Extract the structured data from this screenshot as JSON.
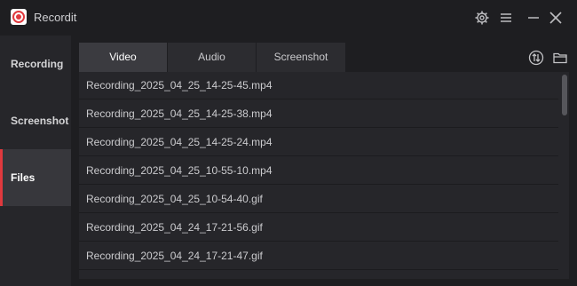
{
  "app": {
    "title": "Recordit"
  },
  "titlebar_icons": [
    "gear-icon",
    "menu-icon",
    "minimize-icon",
    "close-icon"
  ],
  "sidebar": {
    "items": [
      {
        "label": "Recording",
        "active": false
      },
      {
        "label": "Screenshot",
        "active": false
      },
      {
        "label": "Files",
        "active": true
      }
    ]
  },
  "tabs": [
    {
      "label": "Video",
      "active": true
    },
    {
      "label": "Audio",
      "active": false
    },
    {
      "label": "Screenshot",
      "active": false
    }
  ],
  "toolbar_icons": [
    "sort-icon",
    "folder-icon"
  ],
  "files": [
    "Recording_2025_04_25_14-25-45.mp4",
    "Recording_2025_04_25_14-25-38.mp4",
    "Recording_2025_04_25_14-25-24.mp4",
    "Recording_2025_04_25_10-55-10.mp4",
    "Recording_2025_04_25_10-54-40.gif",
    "Recording_2025_04_24_17-21-56.gif",
    "Recording_2025_04_24_17-21-47.gif"
  ],
  "colors": {
    "accent": "#e0393e",
    "background": "#1e1e21",
    "panel": "#26262a"
  }
}
